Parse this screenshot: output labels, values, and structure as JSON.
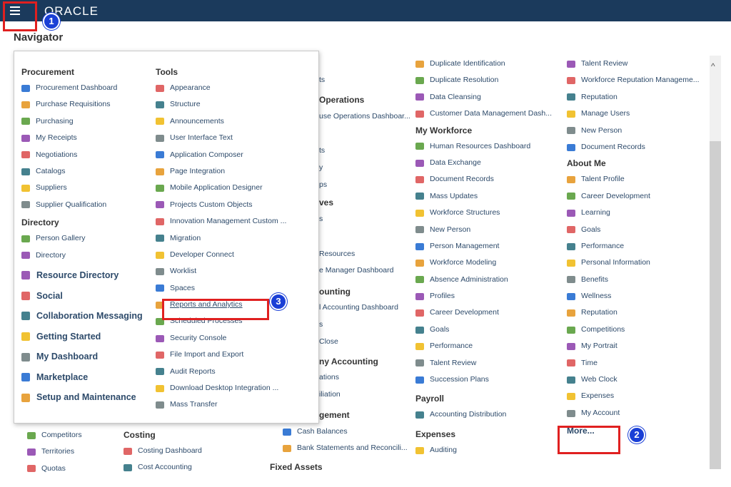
{
  "header": {
    "logo": "ORACLE",
    "page_title": "Navigator"
  },
  "badges": {
    "one": "1",
    "two": "2",
    "three": "3"
  },
  "panel": {
    "procurement": {
      "heading": "Procurement",
      "items": [
        "Procurement Dashboard",
        "Purchase Requisitions",
        "Purchasing",
        "My Receipts",
        "Negotiations",
        "Catalogs",
        "Suppliers",
        "Supplier Qualification"
      ]
    },
    "directory": {
      "heading": "Directory",
      "items": [
        "Person Gallery",
        "Directory"
      ]
    },
    "main_links": [
      "Resource Directory",
      "Social",
      "Collaboration Messaging",
      "Getting Started",
      "My Dashboard",
      "Marketplace",
      "Setup and Maintenance"
    ],
    "tools": {
      "heading": "Tools",
      "items": [
        "Appearance",
        "Structure",
        "Announcements",
        "User Interface Text",
        "Application Composer",
        "Page Integration",
        "Mobile Application Designer",
        "Projects Custom Objects",
        "Innovation Management Custom ...",
        "Migration",
        "Developer Connect",
        "Worklist",
        "Spaces",
        "Reports and Analytics",
        "Scheduled Processes",
        "Security Console",
        "File Import and Export",
        "Audit Reports",
        "Download Desktop Integration ...",
        "Mass Transfer"
      ]
    }
  },
  "behind": {
    "col3_partials": [
      "ts",
      "Operations",
      "use Operations Dashboar...",
      "ts",
      "y",
      "ps",
      "ves",
      "s",
      "Resources",
      "e Manager Dashboard",
      "ounting",
      "l Accounting Dashboard",
      "s",
      "Close",
      "ny Accounting",
      "ations",
      "iliation",
      "gement"
    ],
    "col3_bottom": [
      "Cash Balances",
      "Bank Statements and Reconcili...",
      "Fixed Assets"
    ],
    "col4_top": [
      "Duplicate Identification",
      "Duplicate Resolution",
      "Data Cleansing",
      "Customer Data Management Dash..."
    ],
    "my_workforce": {
      "heading": "My Workforce",
      "items": [
        "Human Resources Dashboard",
        "Data Exchange",
        "Document Records",
        "Mass Updates",
        "Workforce Structures",
        "New Person",
        "Person Management",
        "Workforce Modeling",
        "Absence Administration",
        "Profiles",
        "Career Development",
        "Goals",
        "Performance",
        "Talent Review",
        "Succession Plans"
      ]
    },
    "payroll": {
      "heading": "Payroll",
      "items": [
        "Accounting Distribution"
      ]
    },
    "expenses": {
      "heading": "Expenses",
      "items": [
        "Auditing"
      ]
    },
    "col5_top": [
      "Talent Review",
      "Workforce Reputation Manageme...",
      "Reputation",
      "Manage Users",
      "New Person",
      "Document Records"
    ],
    "about_me": {
      "heading": "About Me",
      "items": [
        "Talent Profile",
        "Career Development",
        "Learning",
        "Goals",
        "Performance",
        "Personal Information",
        "Benefits",
        "Wellness",
        "Reputation",
        "Competitions",
        "My Portrait",
        "Time",
        "Web Clock",
        "Expenses",
        "My Account"
      ]
    },
    "more": "More...",
    "bottom_left": [
      "Competitors",
      "Territories",
      "Quotas"
    ],
    "costing": {
      "heading": "Costing",
      "items": [
        "Costing Dashboard",
        "Cost Accounting"
      ]
    }
  },
  "colors": {
    "topbar": "#1b3a5c",
    "link": "#2d4a6a",
    "highlight": "#e02020",
    "badge": "#1a3fd6"
  }
}
